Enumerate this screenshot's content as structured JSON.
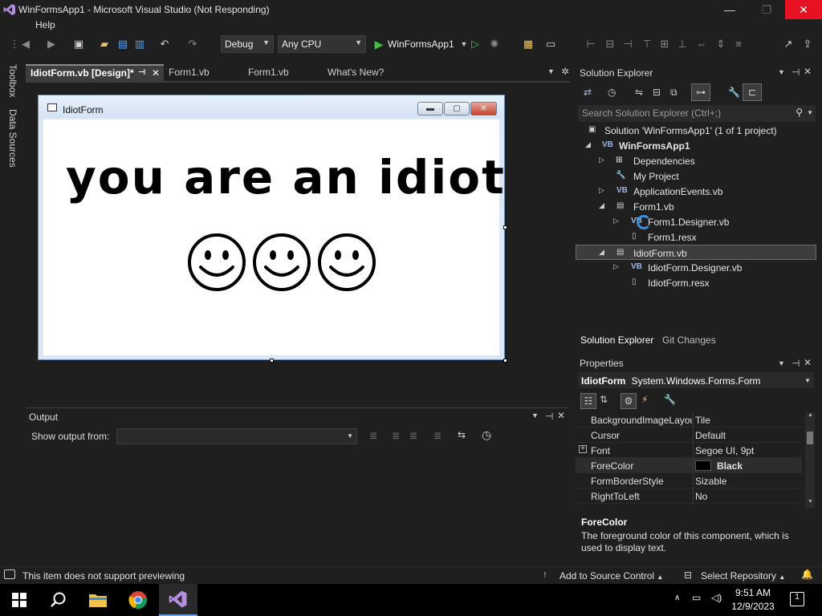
{
  "window": {
    "title": "WinFormsApp1 - Microsoft Visual Studio (Not Responding)",
    "controls": {
      "minimize": "—",
      "maximize": "❐",
      "close": "✕"
    }
  },
  "menu": {
    "help": "Help"
  },
  "toolbar": {
    "config": "Debug",
    "platform": "Any CPU",
    "run_target": "WinFormsApp1"
  },
  "side_tabs": [
    "Toolbox",
    "Data Sources"
  ],
  "doc_tabs": [
    {
      "label": "IdiotForm.vb [Design]*",
      "active": true
    },
    {
      "label": "Form1.vb",
      "active": false
    },
    {
      "label": "Form1.vb",
      "active": false
    },
    {
      "label": "What's New?",
      "active": false
    }
  ],
  "designer": {
    "form_title": "IdiotForm",
    "form_text": "you are an idiot",
    "smiley_count": 3
  },
  "output": {
    "title": "Output",
    "show_label": "Show output from:"
  },
  "solution_explorer": {
    "title": "Solution Explorer",
    "search_placeholder": "Search Solution Explorer (Ctrl+;)",
    "items": [
      {
        "label": "Solution 'WinFormsApp1' (1 of 1 project)",
        "icon": "solution-icon"
      },
      {
        "label": "WinFormsApp1",
        "icon": "vb-project-icon",
        "expander": "◢"
      },
      {
        "label": "Dependencies",
        "icon": "dependencies-icon",
        "expander": "▷"
      },
      {
        "label": "My Project",
        "icon": "wrench-icon",
        "expander": ""
      },
      {
        "label": "ApplicationEvents.vb",
        "icon": "vb-file-icon",
        "expander": "▷"
      },
      {
        "label": "Form1.vb",
        "icon": "form-icon",
        "expander": "◢"
      },
      {
        "label": "Form1.Designer.vb",
        "icon": "vb-file-icon",
        "expander": "▷"
      },
      {
        "label": "Form1.resx",
        "icon": "resx-icon",
        "expander": ""
      },
      {
        "label": "IdiotForm.vb",
        "icon": "form-icon",
        "expander": "◢"
      },
      {
        "label": "IdiotForm.Designer.vb",
        "icon": "vb-file-icon",
        "expander": "▷"
      },
      {
        "label": "IdiotForm.resx",
        "icon": "resx-icon",
        "expander": ""
      }
    ],
    "tabs": [
      "Solution Explorer",
      "Git Changes"
    ]
  },
  "properties": {
    "title": "Properties",
    "object_name": "IdiotForm",
    "object_type": "System.Windows.Forms.Form",
    "rows": [
      {
        "name": "BackgroundImageLayout",
        "value": "Tile"
      },
      {
        "name": "Cursor",
        "value": "Default"
      },
      {
        "name": "Font",
        "value": "Segoe UI, 9pt"
      },
      {
        "name": "ForeColor",
        "value": "Black"
      },
      {
        "name": "FormBorderStyle",
        "value": "Sizable"
      },
      {
        "name": "RightToLeft",
        "value": "No"
      }
    ],
    "desc_title": "ForeColor",
    "desc_text": "The foreground color of this component, which is used to display text."
  },
  "statusbar": {
    "message": "This item does not support previewing",
    "source_control": "Add to Source Control",
    "repository": "Select Repository"
  },
  "taskbar": {
    "time": "9:51 AM",
    "date": "12/9/2023",
    "notif_count": "1"
  },
  "colors": {
    "accent": "#68217a",
    "close_red": "#e81123",
    "run_green": "#2ca02c"
  }
}
